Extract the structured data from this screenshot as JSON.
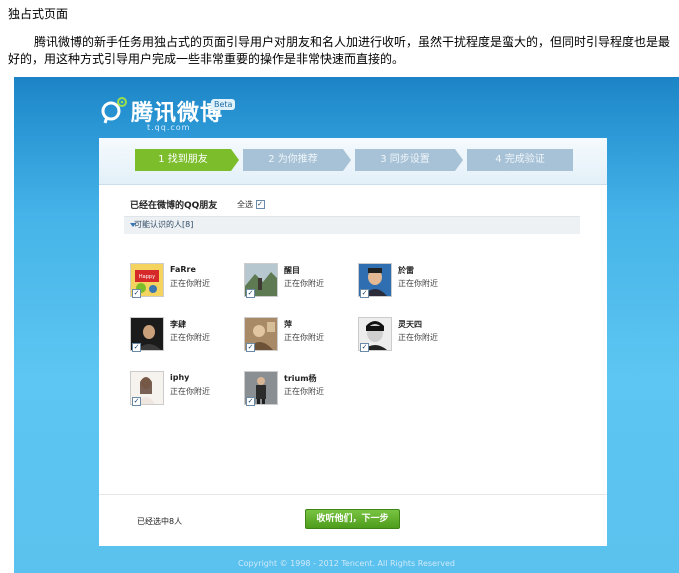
{
  "article": {
    "title": "独占式页面",
    "body": "腾讯微博的新手任务用独占式的页面引导用户对朋友和名人加进行收听，虽然干扰程度是蛮大的，但同时引导程度也是最好的，用这种方式引导用户完成一些非常重要的操作是非常快速而直接的。"
  },
  "app": {
    "logo_text": "腾讯微博",
    "logo_badge": "Beta",
    "domain": "t.qq.com",
    "brand_color": "#2d9ad7"
  },
  "steps": [
    {
      "label": "1 找到朋友",
      "state": "active"
    },
    {
      "label": "2 为你推荐",
      "state": "todo"
    },
    {
      "label": "3 同步设置",
      "state": "todo"
    },
    {
      "label": "4 完成验证",
      "state": "todo"
    }
  ],
  "friends_section": {
    "title": "已经在微博的QQ朋友",
    "select_all": "全选",
    "select_all_checked": true,
    "group_label": "可能认识的人[8]"
  },
  "friends": [
    {
      "name": "FaRre",
      "status": "正在你附近",
      "checked": true,
      "avatar": "avatar-happy-new-year"
    },
    {
      "name": "醒目",
      "status": "正在你附近",
      "checked": true,
      "avatar": "avatar-landscape"
    },
    {
      "name": "於雷",
      "status": "正在你附近",
      "checked": true,
      "avatar": "avatar-portrait-man"
    },
    {
      "name": "李肆",
      "status": "正在你附近",
      "checked": true,
      "avatar": "avatar-dark-portrait"
    },
    {
      "name": "萍",
      "status": "正在你附近",
      "checked": true,
      "avatar": "avatar-sepia-woman"
    },
    {
      "name": "灵天四",
      "status": "正在你附近",
      "checked": true,
      "avatar": "avatar-bw-portrait"
    },
    {
      "name": "iphy",
      "status": "正在你附近",
      "checked": true,
      "avatar": "avatar-woman-white"
    },
    {
      "name": "trium杨",
      "status": "正在你附近",
      "checked": true,
      "avatar": "avatar-man-standing"
    }
  ],
  "footer_bar": {
    "selected_text": "已经选中8人",
    "next_button": "收听他们，下一步"
  },
  "copyright": "Copyright © 1998 - 2012 Tencent. All Rights Reserved"
}
